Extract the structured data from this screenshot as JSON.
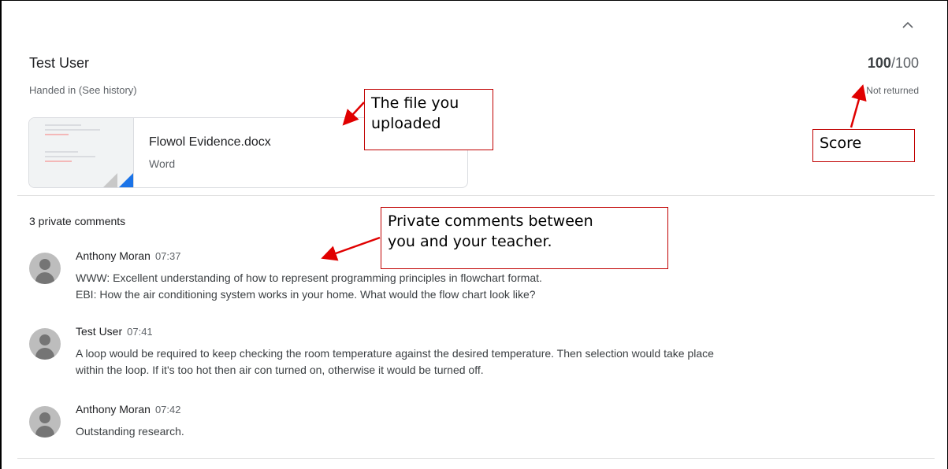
{
  "student": {
    "name": "Test User",
    "status": "Handed in",
    "history_link": "(See history)",
    "score": "100",
    "score_max": "/100",
    "return_status": "Not returned"
  },
  "attachment": {
    "file_name": "Flowol Evidence.docx",
    "file_type": "Word"
  },
  "comments_header": "3 private comments",
  "comments": [
    {
      "author": "Anthony Moran",
      "time": "07:37",
      "line1": "WWW: Excellent understanding of how to represent programming principles in flowchart format.",
      "line2": "EBI: How the air conditioning system works in your home. What would the flow chart look like?"
    },
    {
      "author": "Test User",
      "time": "07:41",
      "line1": "A loop would be required to keep checking the room temperature against the desired temperature. Then selection would take place",
      "line2": "within the loop. If it's too hot then air con turned on, otherwise it would be turned off."
    },
    {
      "author": "Anthony Moran",
      "time": "07:42",
      "line1": "Outstanding research.",
      "line2": ""
    }
  ],
  "annotations": {
    "file_line1": "The file you",
    "file_line2": "uploaded",
    "score": "Score",
    "comments_line1": "Private comments between",
    "comments_line2": "you and your teacher."
  },
  "icons": {
    "collapse": "chevron-up-icon",
    "avatar": "person-avatar-icon",
    "doc_corner": "word-doc-corner-icon"
  },
  "colors": {
    "annotation_border": "#c00000",
    "annotation_arrow": "#e00000",
    "word_blue": "#1a73e8"
  }
}
